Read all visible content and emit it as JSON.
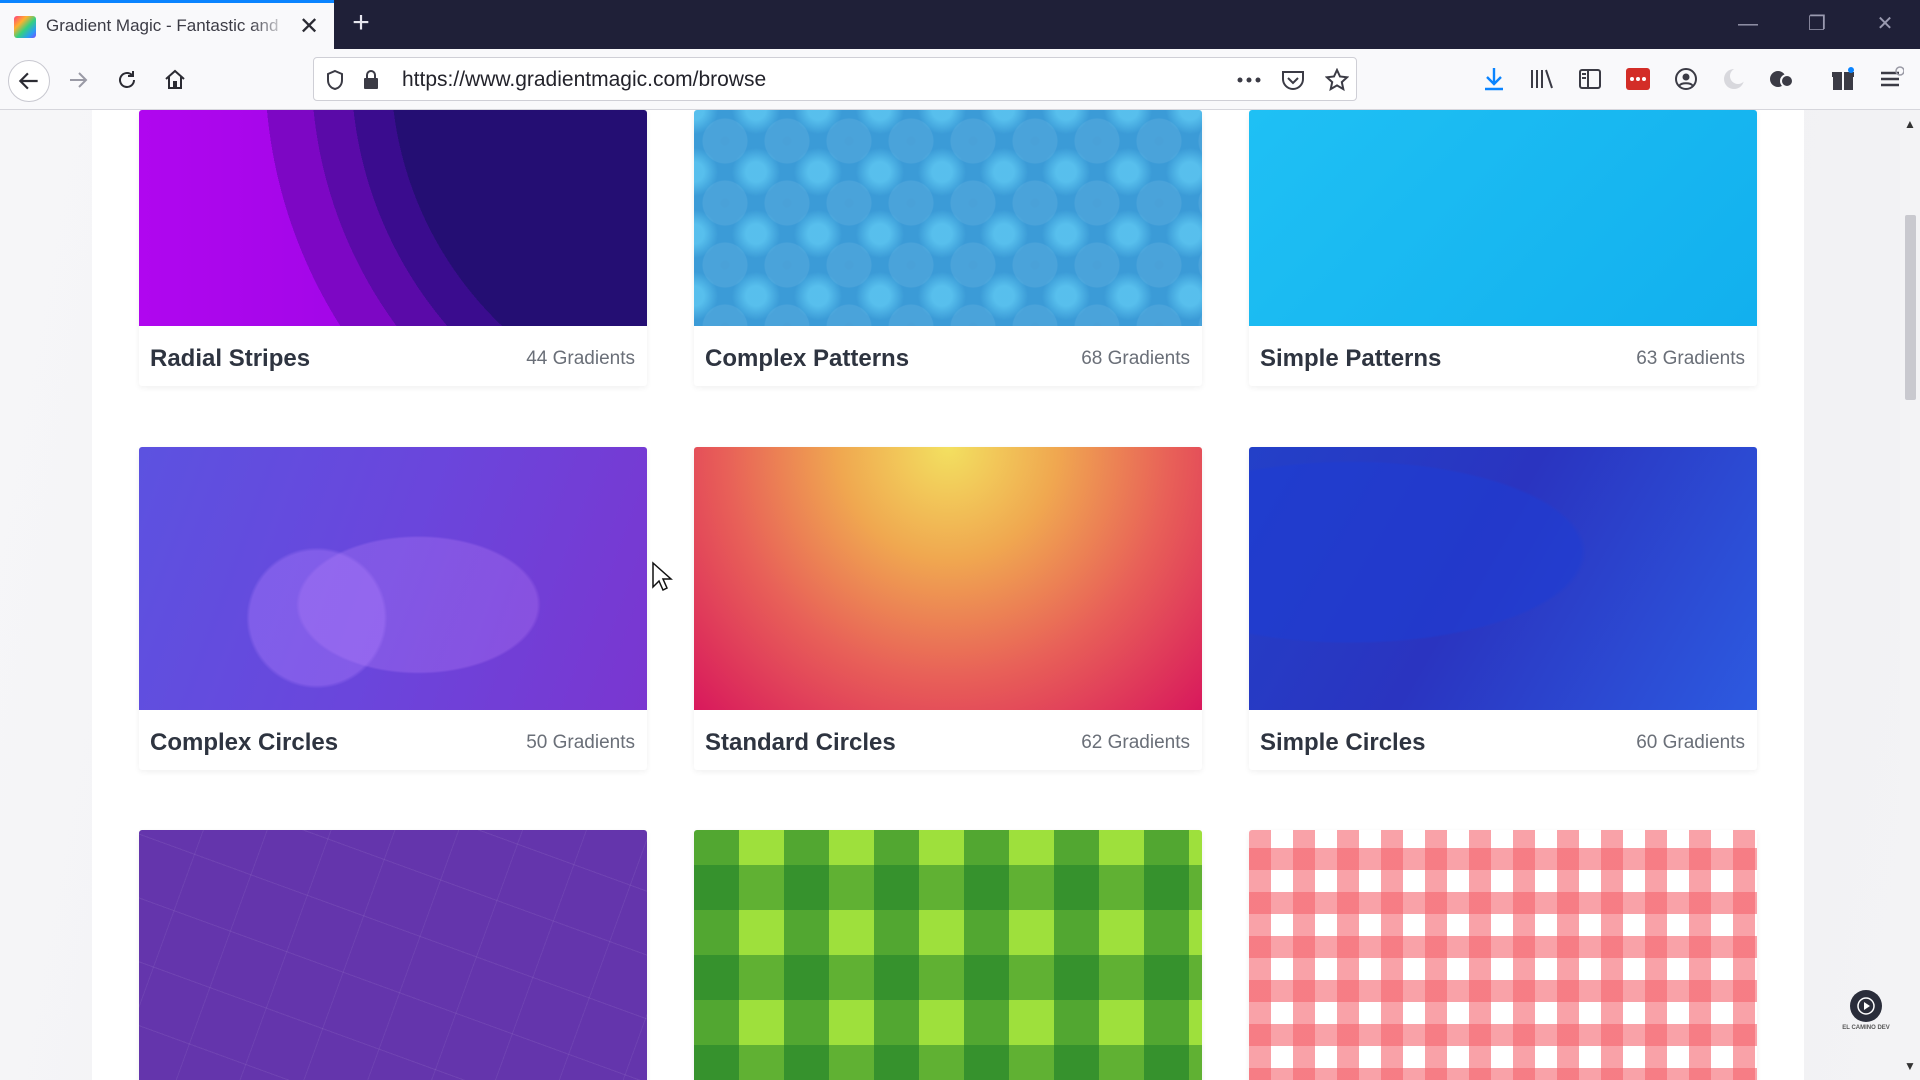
{
  "browser": {
    "tab_title": "Gradient Magic - Fantastic and",
    "tab_close": "✕",
    "new_tab": "+",
    "url": "https://www.gradientmagic.com/browse",
    "window_minimize": "—",
    "window_restore": "❐",
    "window_close": "✕"
  },
  "cards": [
    {
      "name": "Radial Stripes",
      "count": "44 Gradients"
    },
    {
      "name": "Complex Patterns",
      "count": "68 Gradients"
    },
    {
      "name": "Simple Patterns",
      "count": "63 Gradients"
    },
    {
      "name": "Complex Circles",
      "count": "50 Gradients"
    },
    {
      "name": "Standard Circles",
      "count": "62 Gradients"
    },
    {
      "name": "Simple Circles",
      "count": "60 Gradients"
    }
  ],
  "badge": {
    "label": "EL CAMINO DEV"
  },
  "colors": {
    "accent": "#0a84ff",
    "tabstrip": "#1f2038",
    "download": "#0a84ff"
  }
}
